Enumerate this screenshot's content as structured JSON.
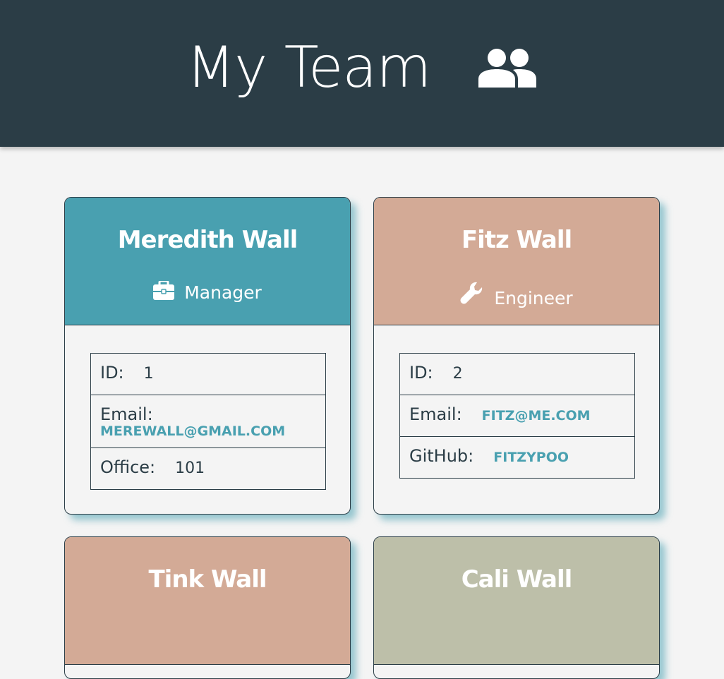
{
  "header": {
    "title": "My Team",
    "icon": "users-icon",
    "background": "#2b3d46"
  },
  "colors": {
    "page_bg": "#f4f4f4",
    "manager": "#49a0b0",
    "engineer": "#d3aa96",
    "intern": "#d3aa96",
    "other": "#bdbfa9",
    "text_dark": "#2b3d46",
    "link": "#49a0b0"
  },
  "cards": [
    {
      "name": "Meredith Wall",
      "role": "Manager",
      "role_icon": "briefcase-icon",
      "id_label": "ID:",
      "id": "1",
      "email_label": "Email:",
      "email": "MEREWALL@GMAIL.COM",
      "extra_label": "Office:",
      "extra": "101"
    },
    {
      "name": "Fitz Wall",
      "role": "Engineer",
      "role_icon": "wrench-icon",
      "id_label": "ID:",
      "id": "2",
      "email_label": "Email:",
      "email": "FITZ@ME.COM",
      "extra_label": "GitHub:",
      "extra": "FITZYPOO"
    },
    {
      "name": "Tink Wall"
    },
    {
      "name": "Cali Wall"
    }
  ]
}
